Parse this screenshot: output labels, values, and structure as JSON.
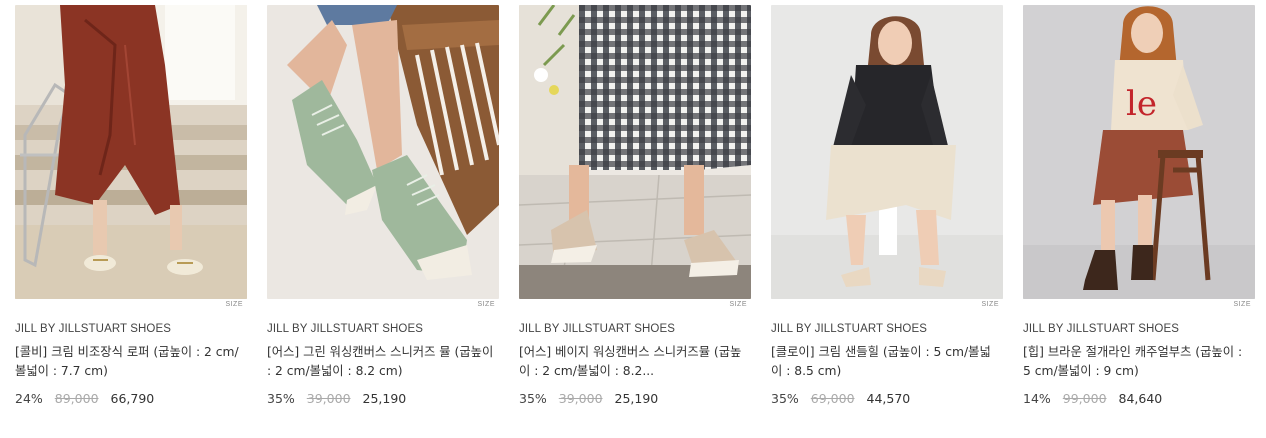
{
  "products": [
    {
      "brand": "JILL BY JILLSTUART SHOES",
      "name": "[콜비] 크림 비조장식 로퍼 (굽높이 : 2 cm/볼넓이 : 7.7 cm)",
      "discount": "24%",
      "original_price": "89,000",
      "sale_price": "66,790",
      "size_label": "SIZE"
    },
    {
      "brand": "JILL BY JILLSTUART SHOES",
      "name": "[어스] 그린 워싱캔버스 스니커즈 뮬 (굽높이 : 2 cm/볼넓이 : 8.2 cm)",
      "discount": "35%",
      "original_price": "39,000",
      "sale_price": "25,190",
      "size_label": "SIZE"
    },
    {
      "brand": "JILL BY JILLSTUART SHOES",
      "name": "[어스] 베이지 워싱캔버스 스니커즈뮬 (굽높이 : 2 cm/볼넓이 : 8.2...",
      "discount": "35%",
      "original_price": "39,000",
      "sale_price": "25,190",
      "size_label": "SIZE"
    },
    {
      "brand": "JILL BY JILLSTUART SHOES",
      "name": "[클로이] 크림 샌들힐 (굽높이 : 5 cm/볼넓이 : 8.5 cm)",
      "discount": "35%",
      "original_price": "69,000",
      "sale_price": "44,570",
      "size_label": "SIZE"
    },
    {
      "brand": "JILL BY JILLSTUART SHOES",
      "name": "[힙] 브라운 절개라인 캐주얼부츠 (굽높이 : 5 cm/볼넓이 : 9 cm)",
      "discount": "14%",
      "original_price": "99,000",
      "sale_price": "84,640",
      "size_label": "SIZE"
    }
  ],
  "colors": {
    "text": "#333333",
    "strike": "#aaaaaa",
    "brand": "#444444"
  }
}
